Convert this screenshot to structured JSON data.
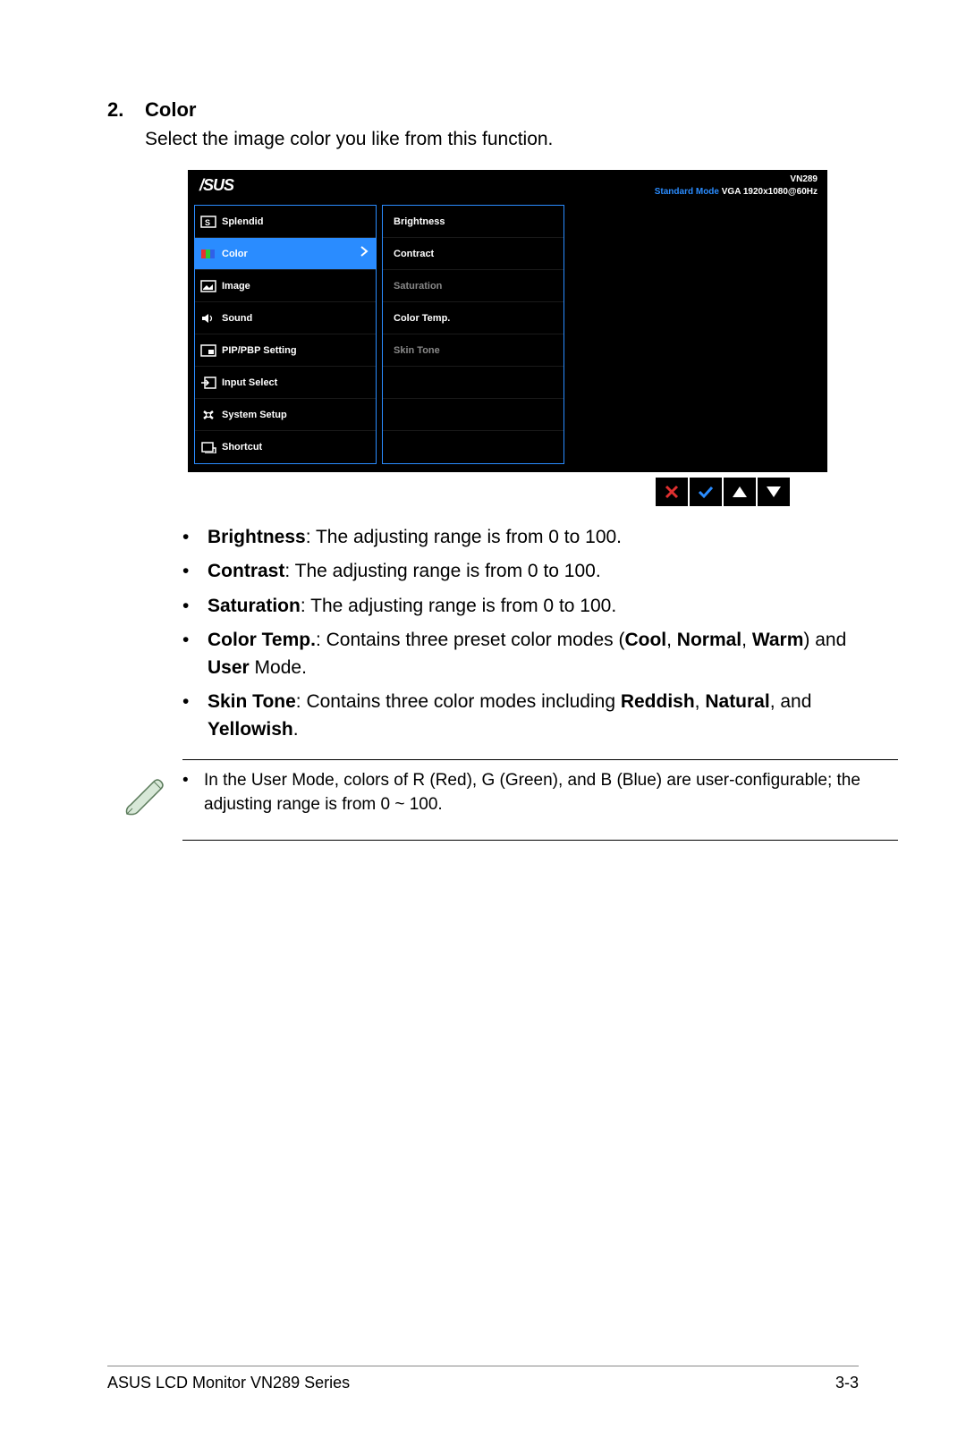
{
  "section": {
    "number": "2.",
    "title": "Color",
    "intro": "Select the image color you like from this function."
  },
  "osd": {
    "logo": "/SUS",
    "model": "VN289",
    "mode_label": "Standard Mode",
    "mode_signal": "VGA 1920x1080@60Hz",
    "left_menu": [
      {
        "label": "Splendid",
        "selected": false
      },
      {
        "label": "Color",
        "selected": true
      },
      {
        "label": "Image",
        "selected": false
      },
      {
        "label": "Sound",
        "selected": false
      },
      {
        "label": "PIP/PBP Setting",
        "selected": false
      },
      {
        "label": "Input Select",
        "selected": false
      },
      {
        "label": "System Setup",
        "selected": false
      },
      {
        "label": "Shortcut",
        "selected": false
      }
    ],
    "right_menu": [
      {
        "label": "Brightness",
        "dim": false
      },
      {
        "label": "Contract",
        "dim": false
      },
      {
        "label": "Saturation",
        "dim": true
      },
      {
        "label": "Color Temp.",
        "dim": false
      },
      {
        "label": "Skin Tone",
        "dim": true
      },
      {
        "label": "",
        "dim": false
      },
      {
        "label": "",
        "dim": false
      },
      {
        "label": "",
        "dim": false
      }
    ]
  },
  "bullets": [
    {
      "bold": "Brightness",
      "rest": ": The adjusting range is from 0 to 100."
    },
    {
      "bold": "Contrast",
      "rest": ": The adjusting range is from 0 to 100."
    },
    {
      "bold": "Saturation",
      "rest": ": The adjusting range is from 0 to 100."
    },
    {
      "bold": "Color Temp.",
      "rest_before": ": Contains three preset color modes (",
      "bold2": "Cool",
      "sep2": ", ",
      "bold3": "Normal",
      "sep3": ", ",
      "bold4": "Warm",
      "rest_after": ") and ",
      "bold5": "User",
      "rest_end": " Mode."
    },
    {
      "bold": "Skin Tone",
      "rest_before": ": Contains three color modes including ",
      "bold2": "Reddish",
      "sep2": ", ",
      "bold3": "Natural",
      "sep3": ", and ",
      "bold4": "Yellowish",
      "rest_after": "."
    }
  ],
  "note": {
    "text": "In the User Mode, colors of R (Red), G (Green), and B (Blue) are user-configurable; the adjusting range is from 0 ~ 100."
  },
  "footer": {
    "left": "ASUS LCD Monitor VN289 Series",
    "right": "3-3"
  }
}
